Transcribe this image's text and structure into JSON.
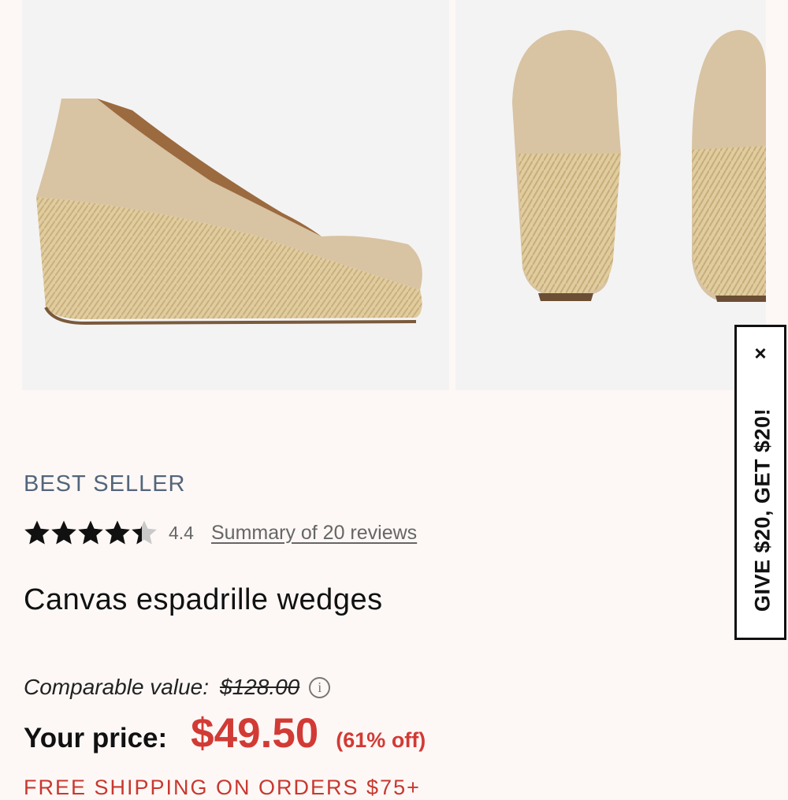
{
  "gallery": {
    "images": [
      {
        "alt": "Canvas espadrille wedge side view"
      },
      {
        "alt": "Canvas espadrille wedges back view"
      }
    ]
  },
  "product": {
    "badge": "BEST SELLER",
    "rating": 4.4,
    "rating_text": "4.4",
    "reviews_link": "Summary of 20 reviews",
    "title": "Canvas espadrille wedges"
  },
  "pricing": {
    "comparable_label": "Comparable value:",
    "comparable_price": "$128.00",
    "info_icon": "info-icon",
    "your_price_label": "Your price:",
    "sale_price": "$49.50",
    "discount": "(61% off)"
  },
  "shipping_banner": "FREE SHIPPING ON ORDERS $75+",
  "promo_tab": {
    "label": "GIVE $20, GET $20!",
    "close": "×"
  },
  "colors": {
    "accent_red": "#d23a35",
    "badge_blue": "#53657b",
    "background": "#fdf8f6"
  }
}
